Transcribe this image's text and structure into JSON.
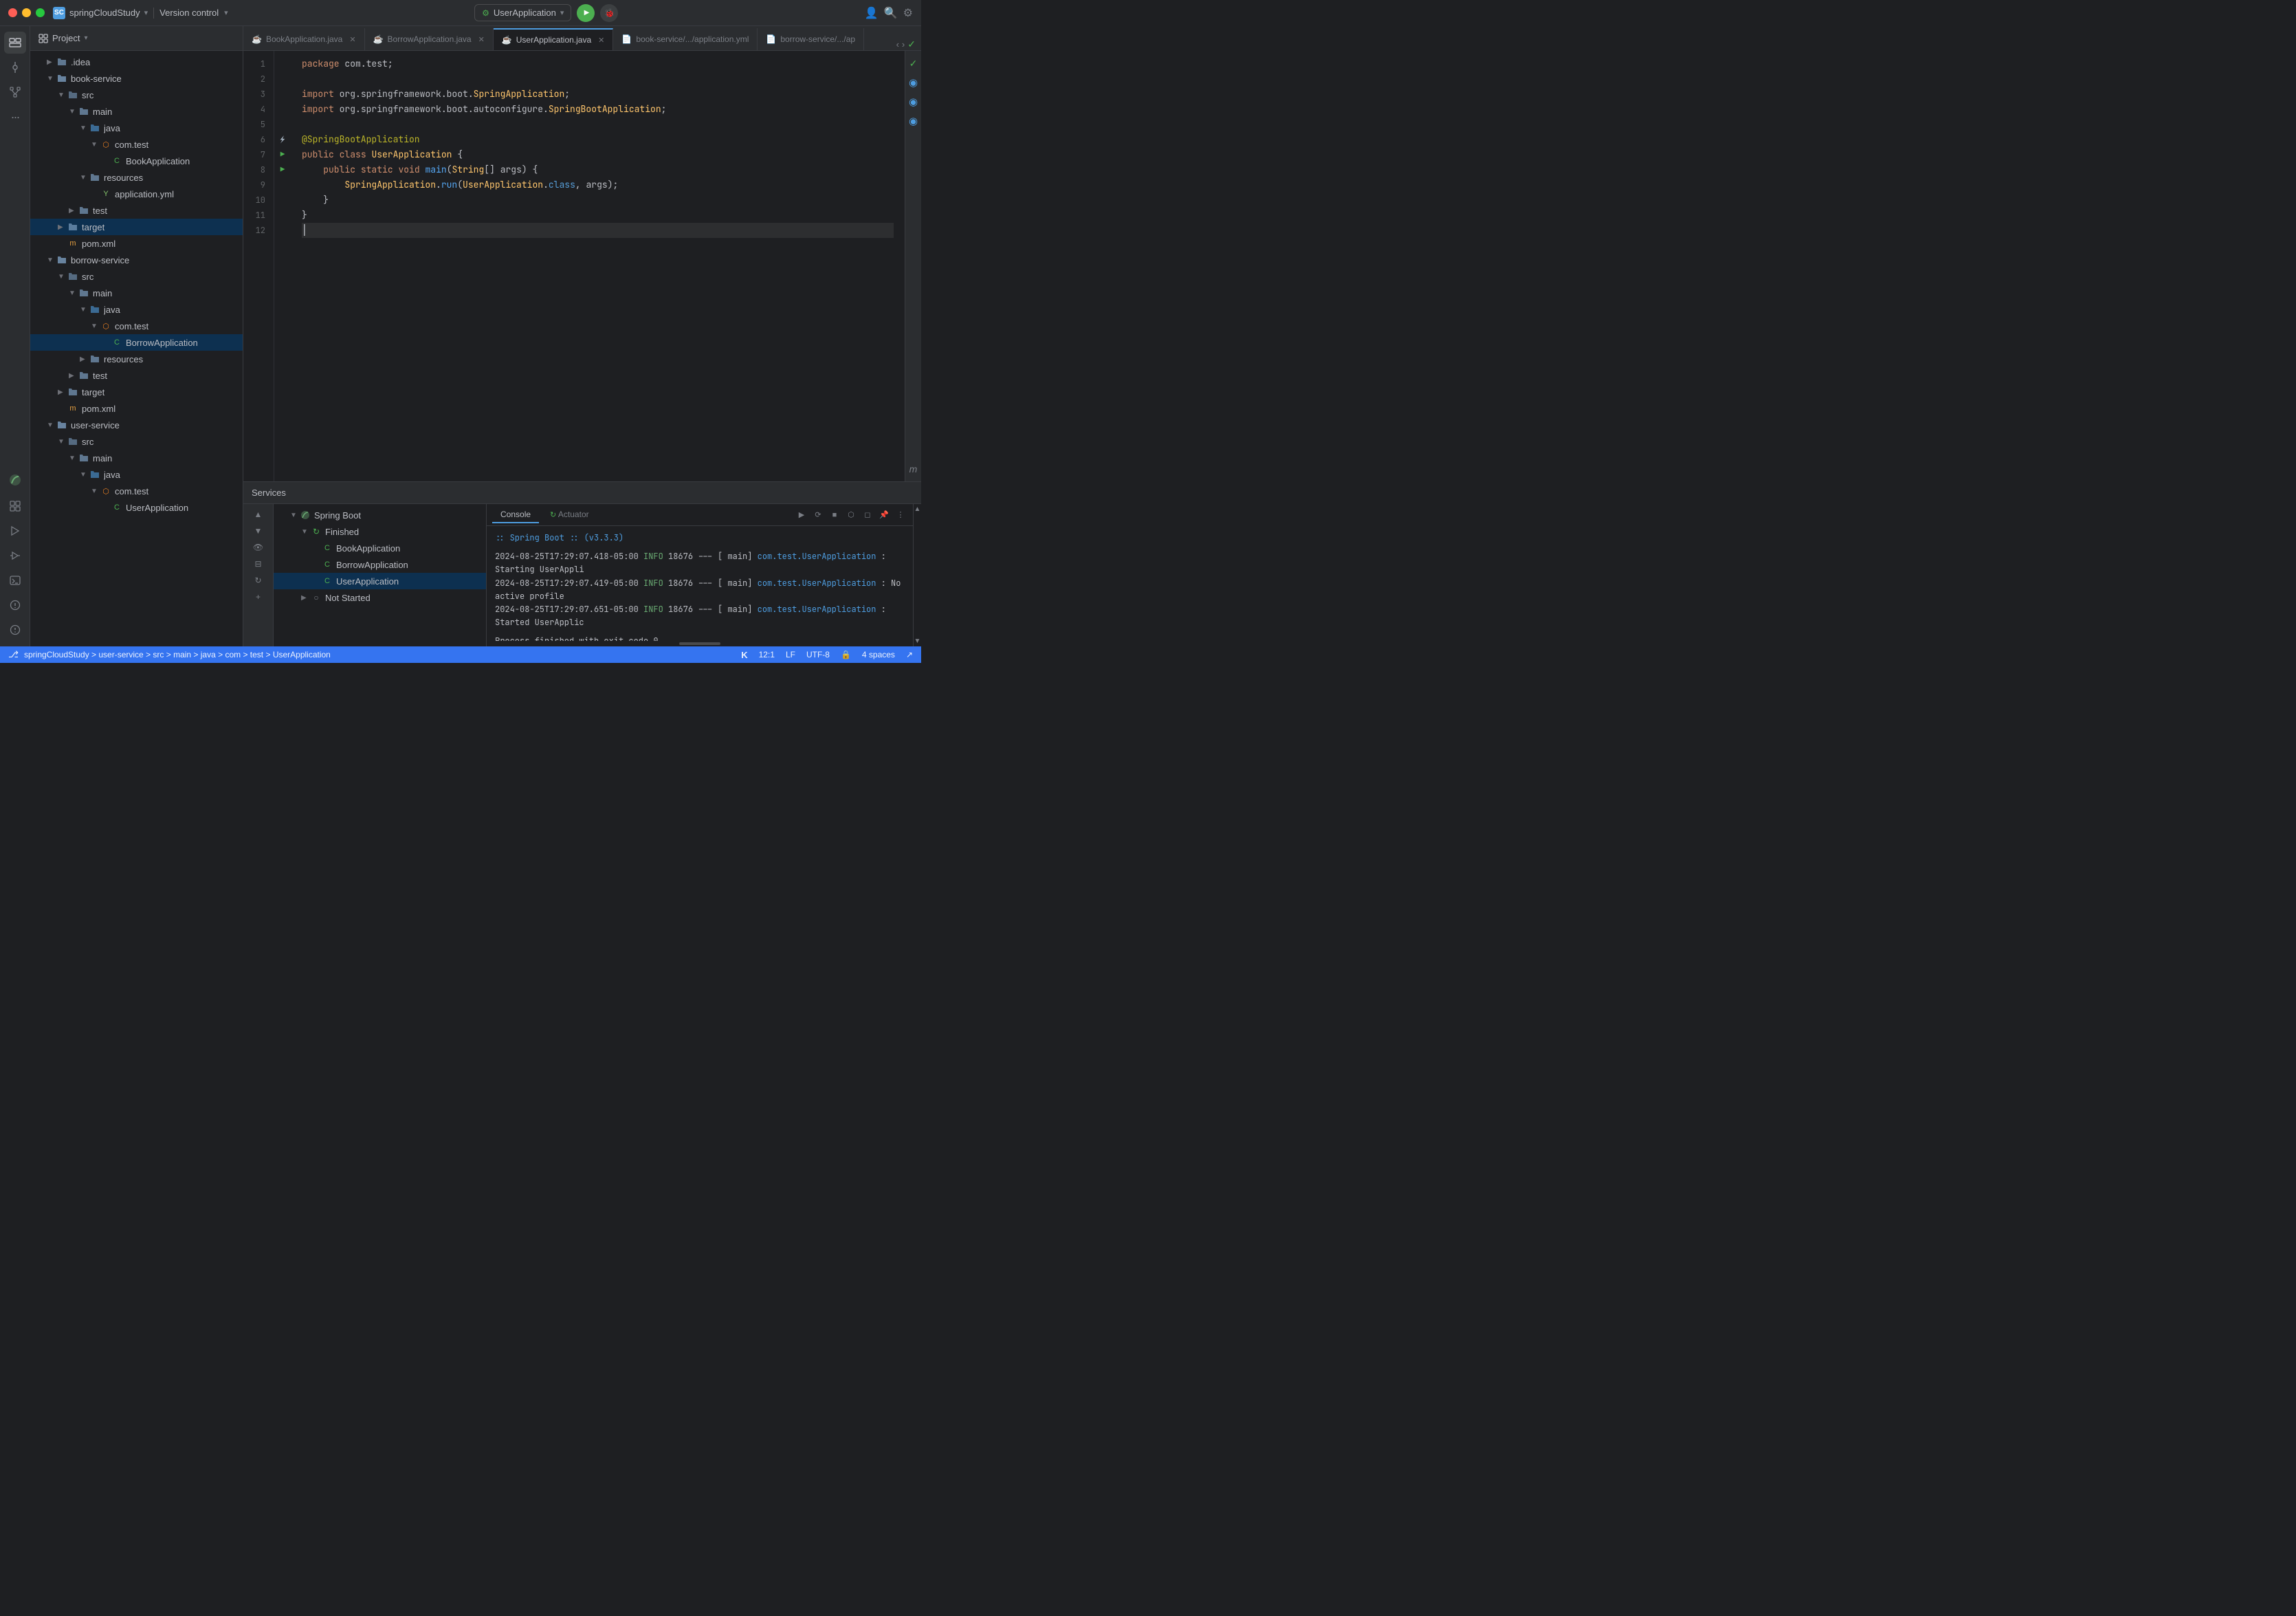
{
  "titlebar": {
    "project_name": "springCloudStudy",
    "project_icon": "SC",
    "version_control": "Version control",
    "run_config": "UserApplication",
    "chevron": "▾"
  },
  "tabs": [
    {
      "label": "BookApplication.java",
      "icon": "☕",
      "active": false,
      "closeable": true
    },
    {
      "label": "BorrowApplication.java",
      "icon": "☕",
      "active": false,
      "closeable": true
    },
    {
      "label": "UserApplication.java",
      "icon": "☕",
      "active": true,
      "closeable": true
    },
    {
      "label": "book-service/.../application.yml",
      "icon": "📄",
      "active": false,
      "closeable": false
    },
    {
      "label": "borrow-service/.../ap",
      "icon": "📄",
      "active": false,
      "closeable": false
    }
  ],
  "code": {
    "lines": [
      {
        "num": 1,
        "content": "package com.test;",
        "gutter": ""
      },
      {
        "num": 2,
        "content": "",
        "gutter": ""
      },
      {
        "num": 3,
        "content": "import org.springframework.boot.SpringApplication;",
        "gutter": ""
      },
      {
        "num": 4,
        "content": "import org.springframework.boot.autoconfigure.SpringBootApplication;",
        "gutter": ""
      },
      {
        "num": 5,
        "content": "",
        "gutter": ""
      },
      {
        "num": 6,
        "content": "@SpringBootApplication",
        "gutter": "annotation"
      },
      {
        "num": 7,
        "content": "public class UserApplication {",
        "gutter": "run"
      },
      {
        "num": 8,
        "content": "    public static void main(String[] args) {",
        "gutter": "run"
      },
      {
        "num": 9,
        "content": "        SpringApplication.run(UserApplication.class, args);",
        "gutter": ""
      },
      {
        "num": 10,
        "content": "    }",
        "gutter": ""
      },
      {
        "num": 11,
        "content": "}",
        "gutter": ""
      },
      {
        "num": 12,
        "content": "",
        "gutter": ""
      }
    ]
  },
  "project_tree": {
    "header": "Project",
    "items": [
      {
        "label": ".idea",
        "type": "folder",
        "level": 1,
        "expanded": false
      },
      {
        "label": "book-service",
        "type": "folder",
        "level": 1,
        "expanded": true
      },
      {
        "label": "src",
        "type": "src-folder",
        "level": 2,
        "expanded": true
      },
      {
        "label": "main",
        "type": "folder",
        "level": 3,
        "expanded": true
      },
      {
        "label": "java",
        "type": "java-folder",
        "level": 4,
        "expanded": true
      },
      {
        "label": "com.test",
        "type": "package",
        "level": 5,
        "expanded": true
      },
      {
        "label": "BookApplication",
        "type": "java-class",
        "level": 6
      },
      {
        "label": "resources",
        "type": "folder",
        "level": 4,
        "expanded": true
      },
      {
        "label": "application.yml",
        "type": "yml",
        "level": 5
      },
      {
        "label": "test",
        "type": "folder",
        "level": 3,
        "expanded": false
      },
      {
        "label": "target",
        "type": "folder",
        "level": 2,
        "expanded": false,
        "selected": true
      },
      {
        "label": "pom.xml",
        "type": "xml",
        "level": 2
      },
      {
        "label": "borrow-service",
        "type": "folder",
        "level": 1,
        "expanded": true
      },
      {
        "label": "src",
        "type": "src-folder",
        "level": 2,
        "expanded": true
      },
      {
        "label": "main",
        "type": "folder",
        "level": 3,
        "expanded": true
      },
      {
        "label": "java",
        "type": "java-folder",
        "level": 4,
        "expanded": true
      },
      {
        "label": "com.test",
        "type": "package",
        "level": 5,
        "expanded": true
      },
      {
        "label": "BorrowApplication",
        "type": "java-class-selected",
        "level": 6
      },
      {
        "label": "resources",
        "type": "folder",
        "level": 4,
        "expanded": false
      },
      {
        "label": "test",
        "type": "folder",
        "level": 3,
        "expanded": false
      },
      {
        "label": "target",
        "type": "folder",
        "level": 2,
        "expanded": false
      },
      {
        "label": "pom.xml",
        "type": "xml",
        "level": 2
      },
      {
        "label": "user-service",
        "type": "folder",
        "level": 1,
        "expanded": true
      },
      {
        "label": "src",
        "type": "src-folder",
        "level": 2,
        "expanded": true
      },
      {
        "label": "main",
        "type": "folder",
        "level": 3,
        "expanded": true
      },
      {
        "label": "java",
        "type": "java-folder",
        "level": 4,
        "expanded": true
      },
      {
        "label": "com.test",
        "type": "package",
        "level": 5,
        "expanded": true
      },
      {
        "label": "UserApplication",
        "type": "java-class",
        "level": 6
      }
    ]
  },
  "services": {
    "header": "Services",
    "tree": [
      {
        "label": "Spring Boot",
        "type": "spring-boot",
        "level": 0,
        "expanded": true
      },
      {
        "label": "Finished",
        "type": "status-finished",
        "level": 1,
        "expanded": true
      },
      {
        "label": "BookApplication",
        "type": "java-class",
        "level": 2
      },
      {
        "label": "BorrowApplication",
        "type": "java-class",
        "level": 2
      },
      {
        "label": "UserApplication",
        "type": "java-class-selected",
        "level": 2
      },
      {
        "label": "Not Started",
        "type": "status-not-started",
        "level": 1,
        "expanded": false
      }
    ]
  },
  "console": {
    "tabs": [
      "Console",
      "Actuator"
    ],
    "active_tab": "Console",
    "spring_boot_banner": "  :: Spring Boot ::        (v3.3.3)",
    "log_lines": [
      {
        "time": "2024-08-25T17:29:07.418-05:00",
        "level": "INFO",
        "pid": "18676",
        "thread": "main",
        "class": "com.test.UserApplication",
        "message": ": Starting UserAppli"
      },
      {
        "time": "2024-08-25T17:29:07.419-05:00",
        "level": "INFO",
        "pid": "18676",
        "thread": "main",
        "class": "com.test.UserApplication",
        "message": ": No active profile"
      },
      {
        "time": "2024-08-25T17:29:07.651-05:00",
        "level": "INFO",
        "pid": "18676",
        "thread": "main",
        "class": "com.test.UserApplication",
        "message": ": Started UserApplic"
      }
    ],
    "exit_message": "Process finished with exit code 0"
  },
  "status_bar": {
    "breadcrumb": "springCloudStudy > user-service > src > main > java > com > test > UserApplication",
    "cursor": "12:1",
    "line_ending": "LF",
    "encoding": "UTF-8",
    "indent": "4 spaces",
    "git_icon": "✓",
    "kotlin_icon": "K"
  },
  "right_panel_icons": [
    "✓",
    "◉",
    "◉",
    "◉",
    "m"
  ],
  "icons": {
    "folder": "📁",
    "java": "☕",
    "xml": "📄",
    "yml": "📄",
    "search": "🔍",
    "gear": "⚙",
    "git": "⎇"
  }
}
